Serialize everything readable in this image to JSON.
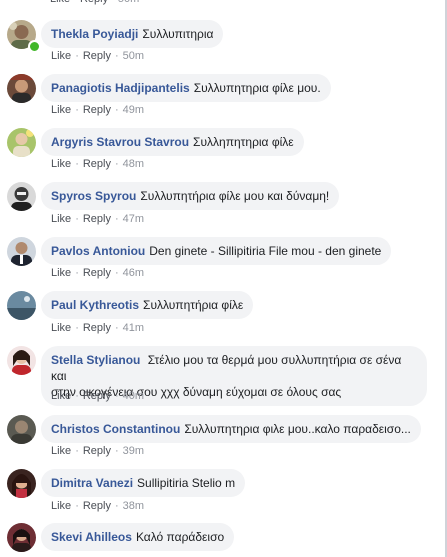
{
  "labels": {
    "like": "Like",
    "reply": "Reply",
    "sep": "·"
  },
  "top": {
    "time": "50m"
  },
  "comments": [
    {
      "author": "Thekla Poyiadji",
      "text": "Συλλυπιτηρια",
      "time": "50m"
    },
    {
      "author": "Panagiotis Hadjipantelis",
      "text": "Συλλυπητηρια φίλε μου.",
      "time": "49m"
    },
    {
      "author": "Argyris Stavrou Stavrou",
      "text": "Συλληπητηρια φίλε",
      "time": "48m"
    },
    {
      "author": "Spyros Spyrou",
      "text": "Συλλυπητήρια φίλε μου και δύναμη!",
      "time": "47m"
    },
    {
      "author": "Pavlos Antoniou",
      "text": "Den ginete - Sillipitiria File mou - den ginete",
      "time": "46m"
    },
    {
      "author": "Paul Kythreotis",
      "text": "Συλλυπητήρια φίλε",
      "time": "41m"
    },
    {
      "author": "Stella Stylianou",
      "text": "Στέλιο μου τα θερμά μου συλλυπητήρια σε σένα και",
      "text2": "στην οικογένεια σου χχχ δύναμη εύχομαι σε όλους σας",
      "time": "40m"
    },
    {
      "author": "Christos Constantinou",
      "text": "Συλλυπητηρια φιλε μου..καλο παραδεισο...",
      "time": "39m"
    },
    {
      "author": "Dimitra Vanezi",
      "text": "Sullipitiria Stelio m",
      "time": "38m"
    },
    {
      "author": "Skevi Ahilleos",
      "text": "Καλό παράδεισο"
    }
  ],
  "colors": {
    "author": "#385898",
    "bubble": "#f2f3f5",
    "meta": "#90949c",
    "online": "#42b72a"
  }
}
